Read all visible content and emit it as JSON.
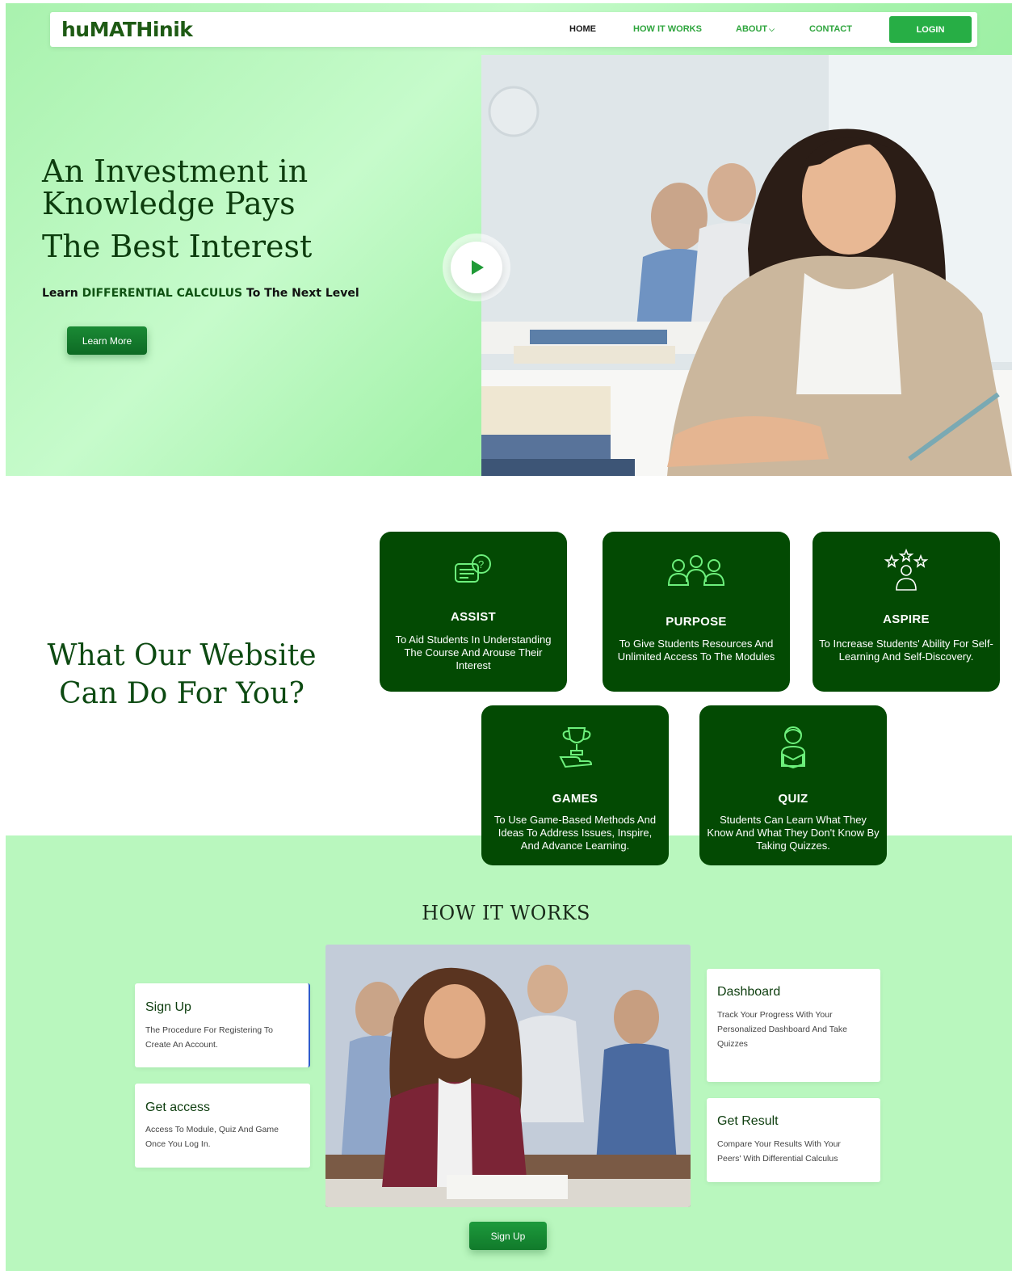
{
  "brand": {
    "logo": "huMATHinik",
    "accent": "#27ae45",
    "dark_green": "#034a03",
    "hero_bg": "#b9f7be"
  },
  "nav": {
    "items": [
      {
        "label": "HOME",
        "active": true
      },
      {
        "label": "HOW IT WORKS",
        "active": false
      },
      {
        "label": "ABOUT",
        "active": false,
        "icon": "chevron-down-icon"
      },
      {
        "label": "CONTACT",
        "active": false
      }
    ],
    "login_label": "LOGIN"
  },
  "hero": {
    "title_line1": "An Investment in",
    "title_line2": "Knowledge Pays",
    "title_line3": "The Best Interest",
    "subtitle_pre": "Learn ",
    "subtitle_highlight": "DIFFERENTIAL CALCULUS",
    "subtitle_post": " To The Next Level",
    "cta_label": "Learn More",
    "play_icon": "play-icon"
  },
  "features": {
    "title_line1": "What Our Website",
    "title_line2": "Can Do For You?",
    "cards": [
      {
        "icon": "question-chat-icon",
        "title": "ASSIST",
        "text": "To Aid Students In Understanding The Course And Arouse Their Interest"
      },
      {
        "icon": "group-icon",
        "title": "PURPOSE",
        "text": "To Give Students Resources And Unlimited Access To The Modules"
      },
      {
        "icon": "stars-person-icon",
        "title": "ASPIRE",
        "text": "To Increase Students' Ability For Self-Learning And Self-Discovery."
      },
      {
        "icon": "trophy-hand-icon",
        "title": "GAMES",
        "text": "To Use Game-Based Methods And Ideas To Address Issues, Inspire, And Advance Learning."
      },
      {
        "icon": "reading-student-icon",
        "title": "QUIZ",
        "text": "Students Can Learn What They Know And What They Don't Know By Taking Quizzes."
      }
    ]
  },
  "how_it_works": {
    "title": "HOW IT WORKS",
    "steps": [
      {
        "title": "Sign Up",
        "text": "The Procedure For Registering To Create An Account."
      },
      {
        "title": "Get access",
        "text": "Access To Module, Quiz And Game Once You Log In."
      },
      {
        "title": "Dashboard",
        "text": " Track Your Progress With Your Personalized Dashboard And Take Quizzes"
      },
      {
        "title": "Get Result",
        "text": "Compare Your Results With Your Peers' With Differential Calculus"
      }
    ],
    "cta_label": "Sign Up"
  }
}
